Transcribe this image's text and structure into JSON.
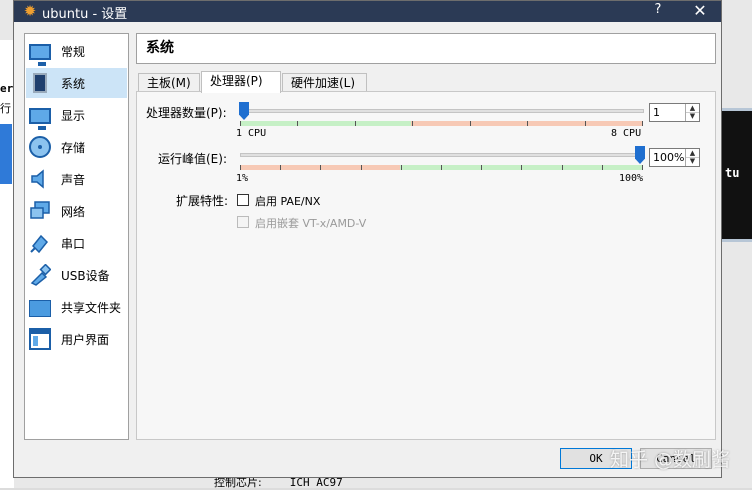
{
  "window": {
    "title": "ubuntu - 设置",
    "help": "?",
    "close": "✕"
  },
  "sidebar": {
    "items": [
      {
        "label": "常规"
      },
      {
        "label": "系统"
      },
      {
        "label": "显示"
      },
      {
        "label": "存储"
      },
      {
        "label": "声音"
      },
      {
        "label": "网络"
      },
      {
        "label": "串口"
      },
      {
        "label": "USB设备"
      },
      {
        "label": "共享文件夹"
      },
      {
        "label": "用户界面"
      }
    ]
  },
  "section_title": "系统",
  "tabs": [
    {
      "label": "主板(M)"
    },
    {
      "label": "处理器(P)"
    },
    {
      "label": "硬件加速(L)"
    }
  ],
  "processor": {
    "label": "处理器数量(P):",
    "value": "1",
    "min_label": "1 CPU",
    "max_label": "8 CPU",
    "level": 0.0
  },
  "execution_cap": {
    "label": "运行峰值(E):",
    "value": "100%",
    "min_label": "1%",
    "max_label": "100%",
    "level": 1.0
  },
  "extended": {
    "label": "扩展特性:",
    "pae_label": "启用 PAE/NX",
    "nested_label": "启用嵌套 VT-x/AMD-V"
  },
  "buttons": {
    "ok": "OK",
    "cancel": "Cancel"
  },
  "watermark": "知乎 @数刷酱",
  "background": {
    "left_text_a": "erv",
    "left_text_b": "行",
    "right_text": "tu",
    "bottom_label": "控制芯片:",
    "bottom_value": "ICH AC97"
  },
  "colors": {
    "titlebar": "#2b3a55",
    "accent": "#1f6fd0",
    "zone_green": "#c6f0c6",
    "zone_red": "#f7c9b5",
    "selection": "#cce4f7"
  }
}
